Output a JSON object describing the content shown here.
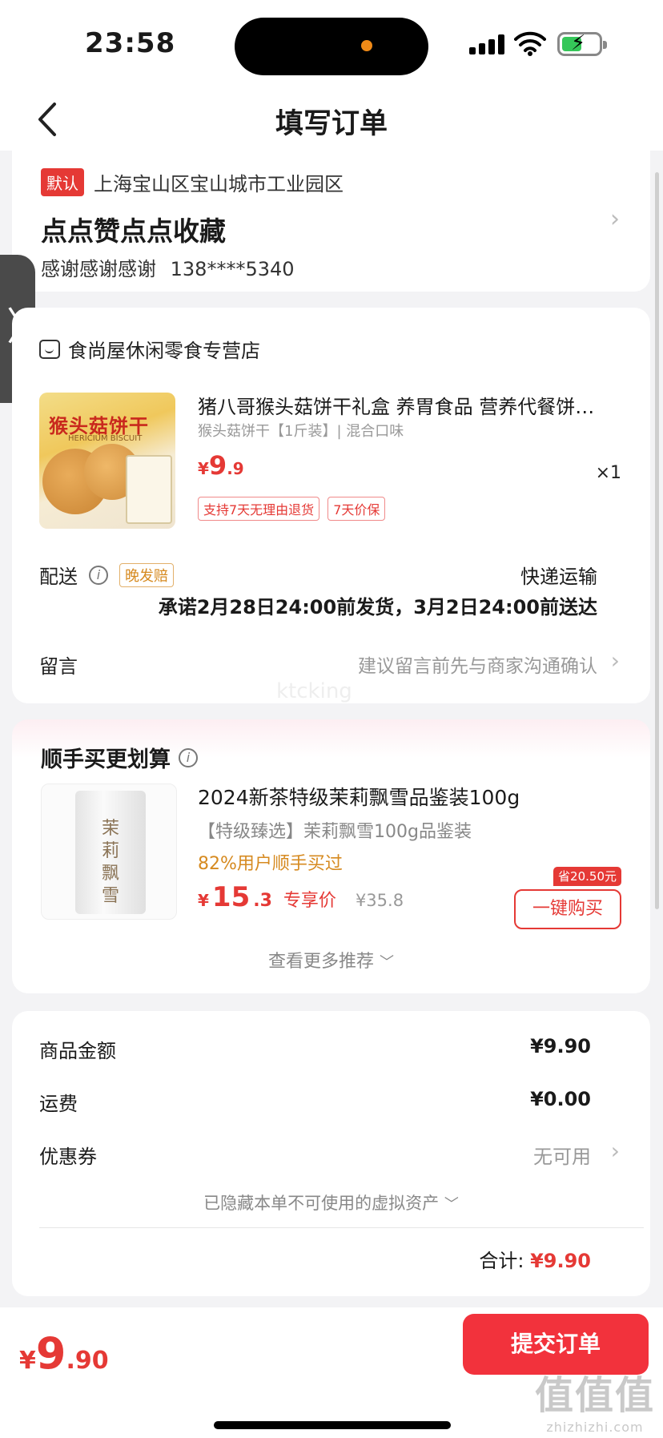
{
  "status_bar": {
    "time": "23:58"
  },
  "nav": {
    "title": "填写订单"
  },
  "address": {
    "default_tag": "默认",
    "region": "上海宝山区宝山城市工业园区",
    "name": "点点赞点点收藏",
    "contact_name": "感谢感谢感谢",
    "phone": "138****5340"
  },
  "store": {
    "name": "食尚屋休闲零食专营店",
    "product": {
      "image_title": "猴头菇饼干",
      "image_subtitle": "HERICIUM BISCUIT",
      "title": "猪八哥猴头菇饼干礼盒 养胃食品 营养代餐饼…",
      "spec": "猴头菇饼干【1斤装】| 混合口味",
      "currency": "¥",
      "price_int": "9",
      "price_dec": ".9",
      "qty": "×1",
      "tags": [
        "支持7天无理由退货",
        "7天价保"
      ]
    },
    "delivery": {
      "label": "配送",
      "late_tag": "晚发赔",
      "method": "快递运输",
      "promise": "承诺2月28日24:00前发货，3月2日24:00前送达"
    },
    "message": {
      "label": "留言",
      "placeholder": "建议留言前先与商家沟通确认"
    },
    "watermark": "ktcking"
  },
  "recommend": {
    "title": "顺手买更划算",
    "product": {
      "image_text": "茉莉飘雪",
      "title": "2024新茶特级茉莉飘雪品鉴装100g",
      "subtitle": "【特级臻选】茉莉飘雪100g品鉴装",
      "social": "82%用户顺手买过",
      "currency": "¥",
      "price_int": "15",
      "price_dec": ".3",
      "price_note": "专享价",
      "orig_price": "¥35.8",
      "save_badge": "省20.50元",
      "buy_label": "一键购买"
    },
    "more": "查看更多推荐"
  },
  "summary": {
    "goods_label": "商品金额",
    "goods_value": "¥9.90",
    "shipping_label": "运费",
    "shipping_value": "¥0.00",
    "coupon_label": "优惠券",
    "coupon_value": "无可用",
    "hidden_assets": "已隐藏本单不可使用的虚拟资产",
    "total_label": "合计:",
    "total_value": "¥9.90"
  },
  "bottom": {
    "currency": "¥",
    "price_int": "9",
    "price_dec": ".90",
    "submit_label": "提交订单",
    "watermark_big": "值值值",
    "watermark_small": "zhizhizhi.com"
  },
  "colors": {
    "accent": "#e53935",
    "submit": "#f2323c",
    "warning": "#d68a20"
  }
}
